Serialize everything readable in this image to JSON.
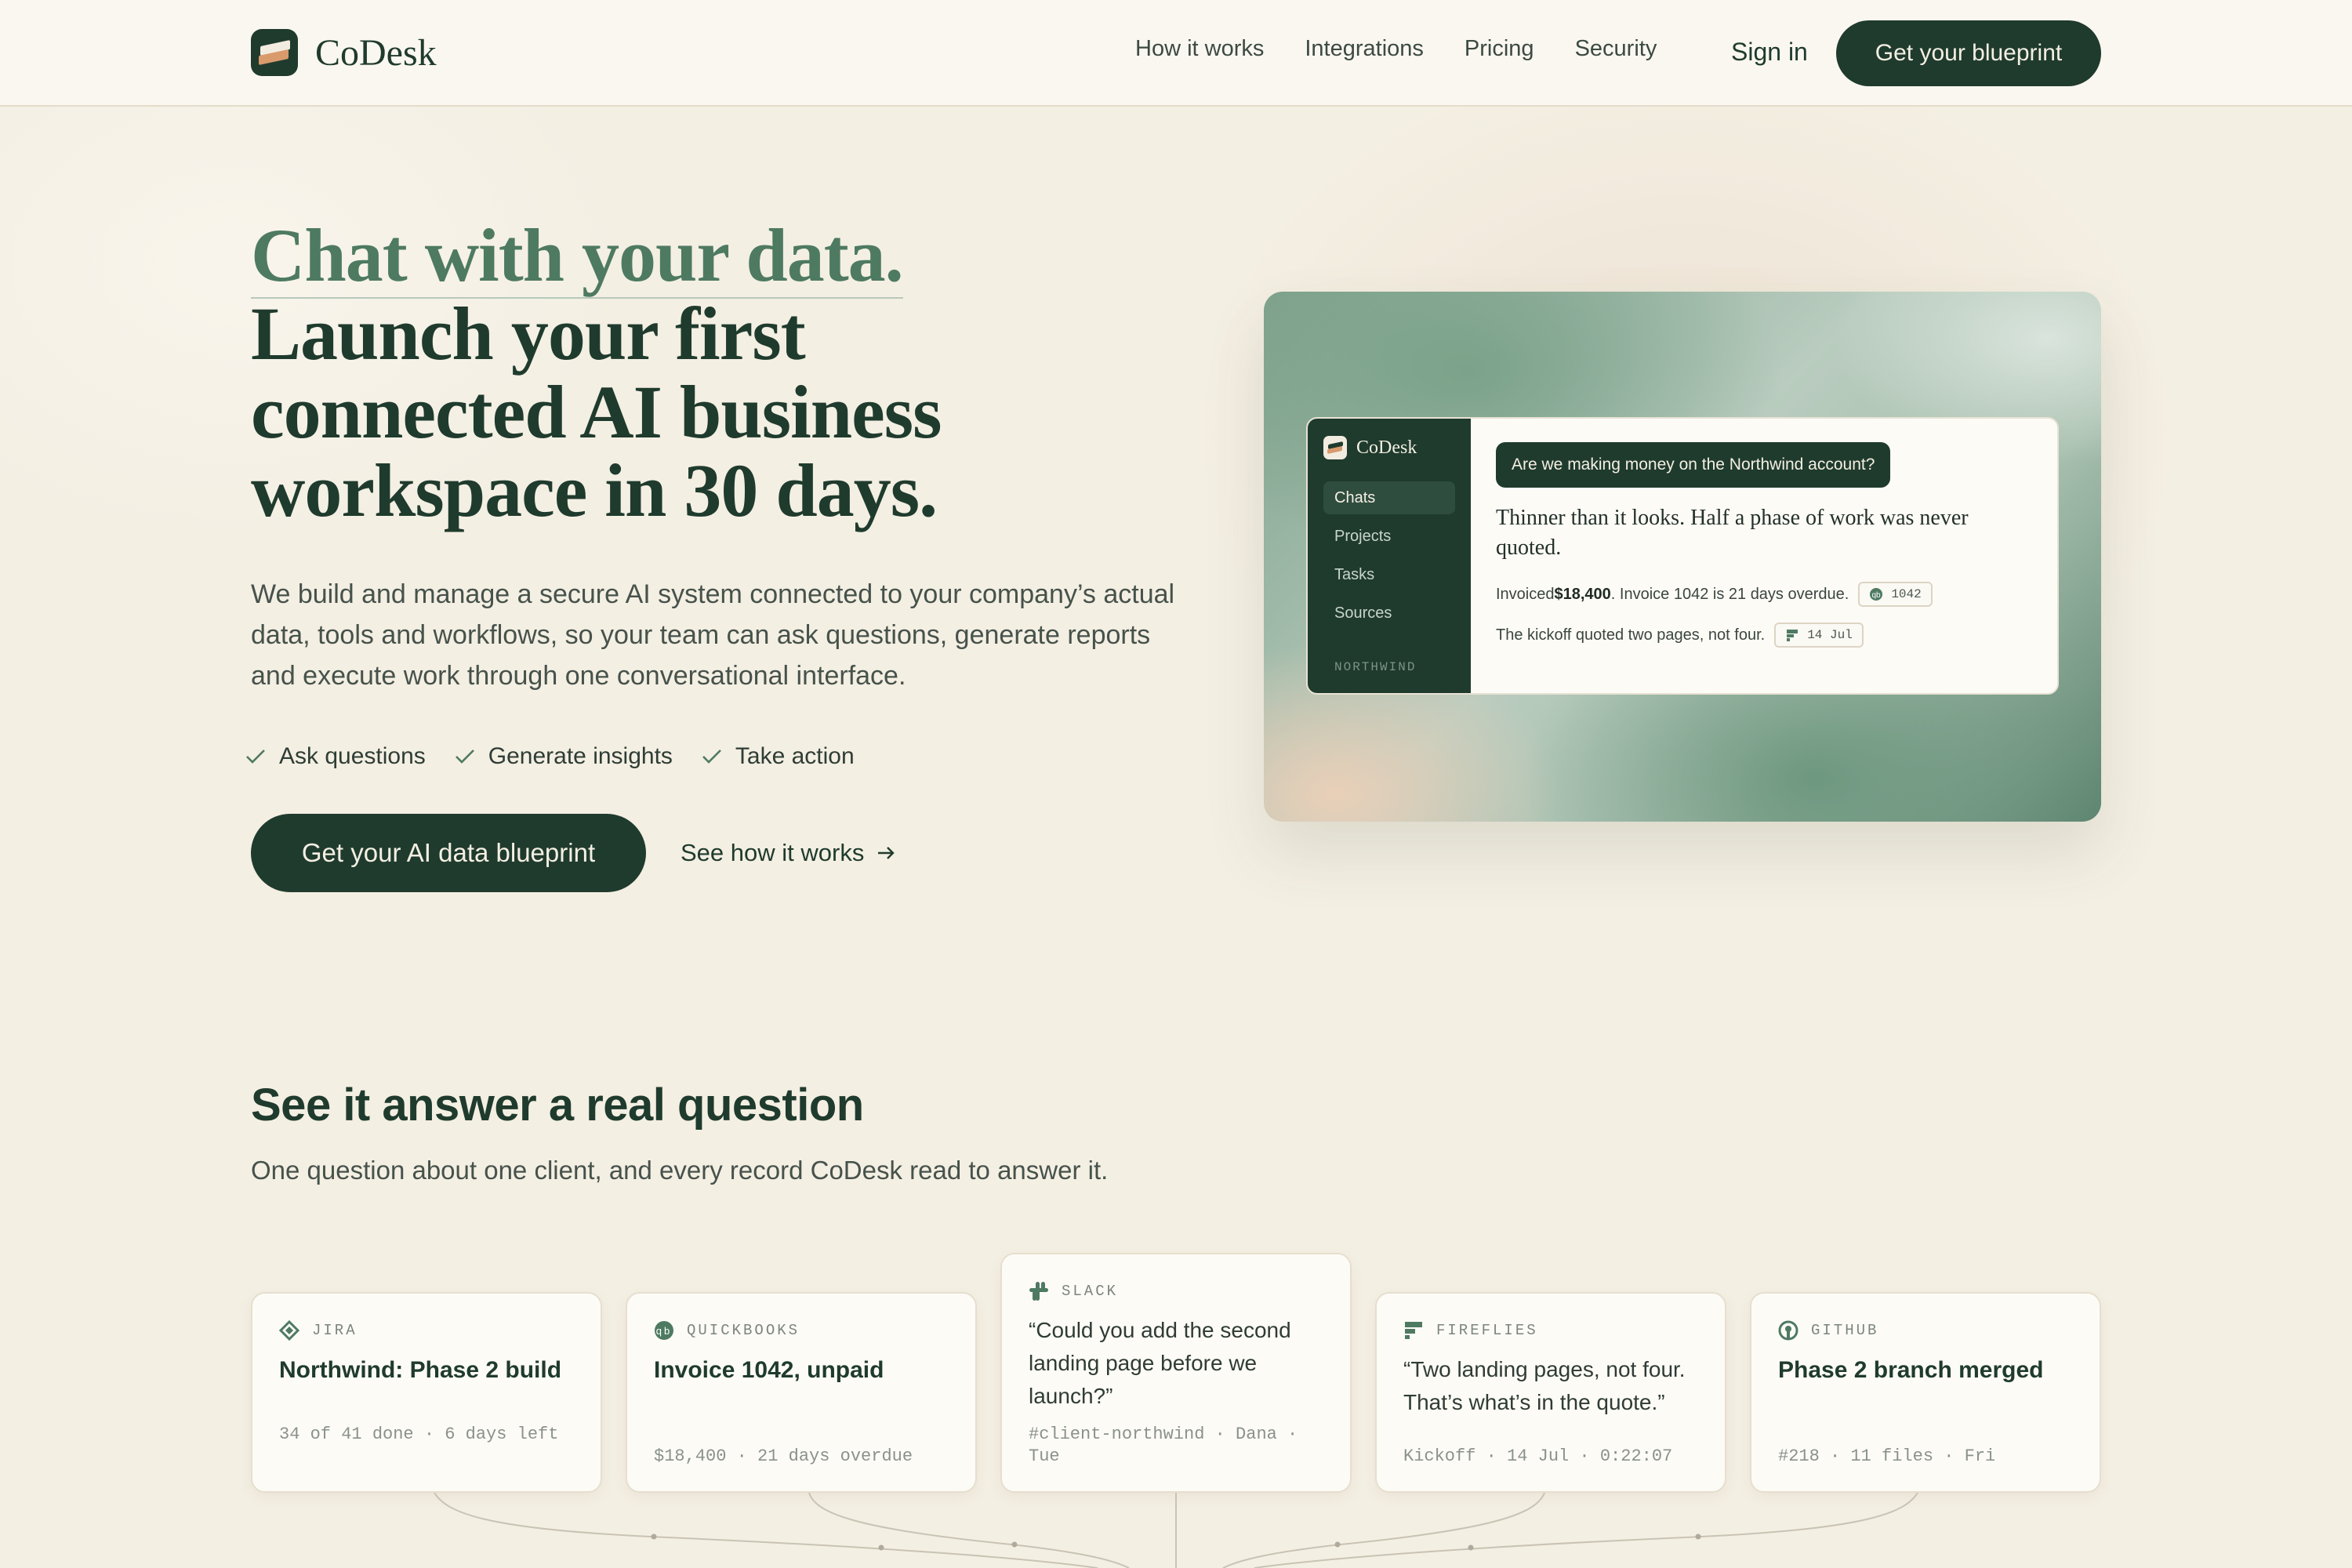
{
  "nav": {
    "brand": "CoDesk",
    "links": [
      "How it works",
      "Integrations",
      "Pricing",
      "Security"
    ],
    "sign_in": "Sign in",
    "cta": "Get your blueprint"
  },
  "hero": {
    "title_line1": "Chat with your data.",
    "title_rest": "Launch your first connected AI business workspace in 30 days.",
    "subtitle": "We build and manage a secure AI system connected to your company’s actual data, tools and workflows, so your team can ask questions, generate reports and execute work through one conversational interface.",
    "checks": [
      "Ask questions",
      "Generate insights",
      "Take action"
    ],
    "cta": "Get your AI data blueprint",
    "link": "See how it works"
  },
  "preview": {
    "brand": "CoDesk",
    "nav_items": [
      "Chats",
      "Projects",
      "Tasks",
      "Sources"
    ],
    "active_item": "Chats",
    "workspace": "NORTHWIND",
    "question": "Are we making money on the Northwind account?",
    "answer": "Thinner than it looks. Half a phase of work was never quoted.",
    "fact1_prefix": "Invoiced ",
    "fact1_amount": "$18,400",
    "fact1_suffix": ". Invoice 1042 is 21 days overdue.",
    "fact1_chip": "1042",
    "fact2": "The kickoff quoted two pages, not four.",
    "fact2_chip": "14 Jul"
  },
  "section": {
    "title": "See it answer a real question",
    "subtitle": "One question about one client, and every record CoDesk read to answer it."
  },
  "sources": [
    {
      "tool": "JIRA",
      "icon": "jira-icon",
      "title": "Northwind: Phase 2 build",
      "meta": "34 of 41 done · 6 days left"
    },
    {
      "tool": "QUICKBOOKS",
      "icon": "quickbooks-icon",
      "title": "Invoice 1042, unpaid",
      "meta": "$18,400 · 21 days overdue"
    },
    {
      "tool": "SLACK",
      "icon": "slack-icon",
      "quote": "“Could you add the second landing page before we launch?”",
      "meta": "#client-northwind · Dana · Tue"
    },
    {
      "tool": "FIREFLIES",
      "icon": "fireflies-icon",
      "quote": "“Two landing pages, not four. That’s what’s in the quote.”",
      "meta": "Kickoff · 14 Jul · 0:22:07"
    },
    {
      "tool": "GITHUB",
      "icon": "github-icon",
      "title": "Phase 2 branch merged",
      "meta": "#218 · 11 files · Fri"
    }
  ],
  "colors": {
    "brand_dark": "#1f3b2d",
    "accent_green": "#4e7a62",
    "cream": "#f4efe3",
    "copper": "#d99a6c"
  }
}
